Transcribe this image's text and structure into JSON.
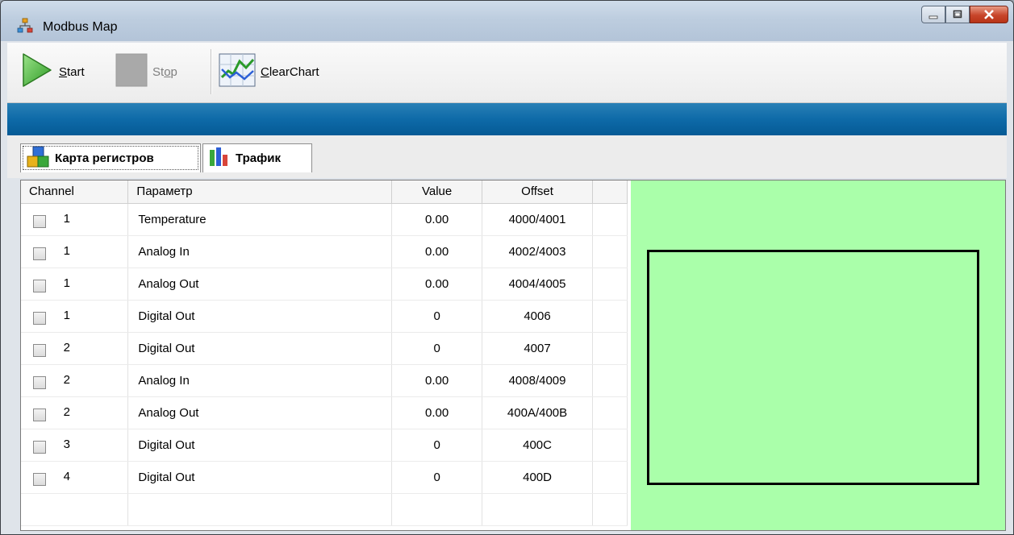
{
  "window": {
    "title": "Modbus Map",
    "app_icon": "network-icon"
  },
  "toolbar": {
    "start": {
      "label_first": "S",
      "label_rest": "tart",
      "icon": "play-icon"
    },
    "stop": {
      "label_first": "St",
      "label_u": "o",
      "label_rest": "p",
      "icon": "stop-icon",
      "enabled": false
    },
    "clear": {
      "label_first": "C",
      "label_rest": "learChart",
      "icon": "chart-icon"
    }
  },
  "tabs": [
    {
      "label": "Карта регистров",
      "icon": "cubes-icon",
      "active": true
    },
    {
      "label": "Трафик",
      "icon": "bar-chart-icon",
      "active": false
    }
  ],
  "table": {
    "headers": [
      "Channel",
      "Параметр",
      "Value",
      "Offset"
    ],
    "rows": [
      {
        "channel": "1",
        "param": "Temperature",
        "value": "0.00",
        "offset": "4000/4001"
      },
      {
        "channel": "1",
        "param": "Analog In",
        "value": "0.00",
        "offset": "4002/4003"
      },
      {
        "channel": "1",
        "param": "Analog Out",
        "value": "0.00",
        "offset": "4004/4005"
      },
      {
        "channel": "1",
        "param": "Digital Out",
        "value": "0",
        "offset": "4006"
      },
      {
        "channel": "2",
        "param": "Digital Out",
        "value": "0",
        "offset": "4007"
      },
      {
        "channel": "2",
        "param": "Analog In",
        "value": "0.00",
        "offset": "4008/4009"
      },
      {
        "channel": "2",
        "param": "Analog Out",
        "value": "0.00",
        "offset": "400A/400B"
      },
      {
        "channel": "3",
        "param": "Digital Out",
        "value": "0",
        "offset": "400C"
      },
      {
        "channel": "4",
        "param": "Digital Out",
        "value": "0",
        "offset": "400D"
      }
    ]
  },
  "colors": {
    "chart_bg": "#aaffaa",
    "band": "#0e6aa8"
  }
}
